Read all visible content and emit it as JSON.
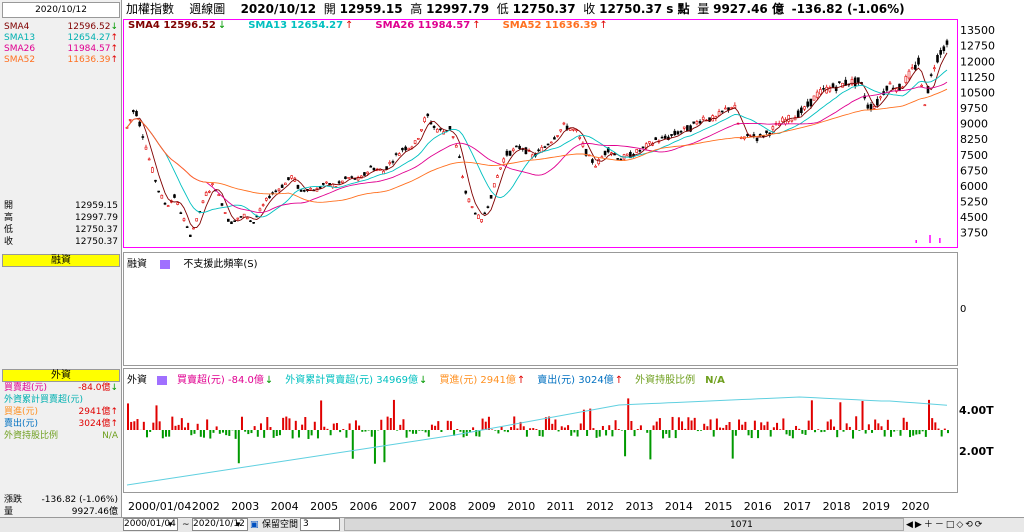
{
  "date": "2020/10/12",
  "topbar": {
    "name": "加權指數",
    "period": "週線圖",
    "date": "2020/10/12",
    "open_label": "開",
    "open": "12959.15",
    "high_label": "高",
    "high": "12997.79",
    "low_label": "低",
    "low": "12750.37",
    "close_label": "收",
    "close": "12750.37 s 點",
    "volume_label": "量",
    "volume": "9927.46 億",
    "change": "-136.82 (-1.06%)"
  },
  "sma": [
    {
      "label": "SMA4",
      "value": "12596.52",
      "arrow": "↓",
      "color": "#800000"
    },
    {
      "label": "SMA13",
      "value": "12654.27",
      "arrow": "↑",
      "color": "#00b0b0"
    },
    {
      "label": "SMA26",
      "value": "11984.57",
      "arrow": "↑",
      "color": "#e00090"
    },
    {
      "label": "SMA52",
      "value": "11636.39",
      "arrow": "↑",
      "color": "#ff7020"
    }
  ],
  "sma_legend": [
    {
      "text": "SMA4 12596.52",
      "arrow": "↓",
      "color": "#800000"
    },
    {
      "text": "SMA13 12654.27",
      "arrow": "↑",
      "color": "#00c0c0"
    },
    {
      "text": "SMA26 11984.57",
      "arrow": "↑",
      "color": "#e00090"
    },
    {
      "text": "SMA52 11636.39",
      "arrow": "↑",
      "color": "#ff7020"
    }
  ],
  "ohlc": [
    {
      "label": "開",
      "value": "12959.15"
    },
    {
      "label": "高",
      "value": "12997.79"
    },
    {
      "label": "低",
      "value": "12750.37"
    },
    {
      "label": "收",
      "value": "12750.37"
    }
  ],
  "margin_panel": {
    "title": "融資",
    "legend_label": "融資",
    "legend_note": "不支援此頻率(S)",
    "axis_value": "0"
  },
  "foreign_panel": {
    "title": "外資",
    "rows": [
      {
        "label": "買賣超(元)",
        "value": "-84.0億",
        "arrow": "↓",
        "color": "#e00090"
      },
      {
        "label": "外資累計買賣超(元)",
        "value": "",
        "arrow": "",
        "color": "#00b0b0"
      },
      {
        "label": "買進(元)",
        "value": "2941億",
        "arrow": "↑",
        "color": "#ff9020"
      },
      {
        "label": "賣出(元)",
        "value": "3024億",
        "arrow": "↑",
        "color": "#0070c0"
      },
      {
        "label": "外資持股比例",
        "value": "N/A",
        "arrow": "",
        "color": "#70a020"
      }
    ],
    "legend": [
      {
        "text": "外資",
        "color": "#000"
      },
      {
        "text": "買賣超(元) -84.0億",
        "arrow": "↓",
        "color": "#e00090"
      },
      {
        "text": "外資累計買賣超(元) 34969億",
        "arrow": "↓",
        "color": "#00c0c0"
      },
      {
        "text": "買進(元) 2941億",
        "arrow": "↑",
        "color": "#ff9020"
      },
      {
        "text": "賣出(元) 3024億",
        "arrow": "↑",
        "color": "#0070c0"
      },
      {
        "text": "外資持股比例",
        "arrow": "",
        "color": "#70a020"
      },
      {
        "text": "N/A",
        "arrow": "",
        "color": "#70a020"
      }
    ],
    "axis_labels": [
      "4.00T",
      "2.00T"
    ]
  },
  "summary": [
    {
      "label": "漲跌",
      "value": "-136.82 (-1.06%)"
    },
    {
      "label": "量",
      "value": "9927.46億"
    }
  ],
  "bottom": {
    "start_date": "2000/01/04",
    "tilde": "~",
    "end_date": "2020/10/12",
    "keep_space_label": "保留空間",
    "keep_space_value": "3",
    "scroll_value": "1071"
  },
  "chart_data": {
    "type": "line",
    "title": "",
    "x_labels": [
      "2000/01/04",
      "2002",
      "2003",
      "2004",
      "2005",
      "2006",
      "2007",
      "2008",
      "2009",
      "2010",
      "2011",
      "2012",
      "2013",
      "2014",
      "2015",
      "2016",
      "2017",
      "2018",
      "2019",
      "2020"
    ],
    "y_ticks": [
      13500,
      12750,
      12000,
      11250,
      10500,
      9750,
      9000,
      8250,
      7500,
      6750,
      6000,
      5250,
      4500,
      3750
    ],
    "ylim": [
      3300,
      13700
    ],
    "price_series": {
      "name": "加權指數",
      "x": [
        2000.0,
        2000.2,
        2000.4,
        2000.6,
        2000.8,
        2001.0,
        2001.2,
        2001.4,
        2001.6,
        2001.8,
        2002.0,
        2002.2,
        2002.4,
        2002.6,
        2002.8,
        2003.0,
        2003.2,
        2003.4,
        2003.6,
        2003.8,
        2004.0,
        2004.2,
        2004.4,
        2004.6,
        2004.8,
        2005.0,
        2005.3,
        2005.6,
        2005.9,
        2006.2,
        2006.5,
        2006.8,
        2007.0,
        2007.3,
        2007.6,
        2007.8,
        2008.0,
        2008.2,
        2008.4,
        2008.6,
        2008.8,
        2009.0,
        2009.2,
        2009.4,
        2009.6,
        2009.8,
        2010.0,
        2010.3,
        2010.6,
        2010.9,
        2011.1,
        2011.4,
        2011.7,
        2011.9,
        2012.2,
        2012.5,
        2012.8,
        2013.1,
        2013.4,
        2013.7,
        2014.0,
        2014.3,
        2014.6,
        2014.9,
        2015.2,
        2015.4,
        2015.6,
        2015.8,
        2016.0,
        2016.3,
        2016.6,
        2016.9,
        2017.2,
        2017.5,
        2017.8,
        2018.0,
        2018.3,
        2018.6,
        2018.8,
        2019.0,
        2019.3,
        2019.6,
        2019.9,
        2020.1,
        2020.2,
        2020.3,
        2020.5,
        2020.7,
        2020.8
      ],
      "y": [
        8800,
        9800,
        8500,
        7000,
        5800,
        5000,
        5500,
        4600,
        3600,
        4500,
        5600,
        6100,
        5200,
        4200,
        4400,
        4600,
        4200,
        4900,
        5500,
        5800,
        6100,
        6500,
        5700,
        5900,
        5800,
        6100,
        6000,
        6400,
        6300,
        6900,
        6700,
        7400,
        7800,
        8000,
        9400,
        8800,
        8600,
        8800,
        7600,
        5600,
        4800,
        4300,
        5300,
        6500,
        7500,
        7700,
        7900,
        7400,
        7900,
        8500,
        8900,
        8600,
        7400,
        7000,
        7800,
        7300,
        7500,
        7800,
        8200,
        8300,
        8600,
        8800,
        9300,
        9200,
        9700,
        9900,
        8100,
        8500,
        8300,
        8600,
        9100,
        9300,
        9700,
        10400,
        10700,
        10800,
        11000,
        11000,
        9800,
        9900,
        10900,
        10700,
        11500,
        12000,
        9800,
        10500,
        12000,
        12700,
        12750
      ]
    },
    "series": [
      {
        "name": "SMA4",
        "color": "#800000"
      },
      {
        "name": "SMA13",
        "color": "#00c0c0"
      },
      {
        "name": "SMA26",
        "color": "#e00090"
      },
      {
        "name": "SMA52",
        "color": "#ff7020"
      }
    ]
  }
}
